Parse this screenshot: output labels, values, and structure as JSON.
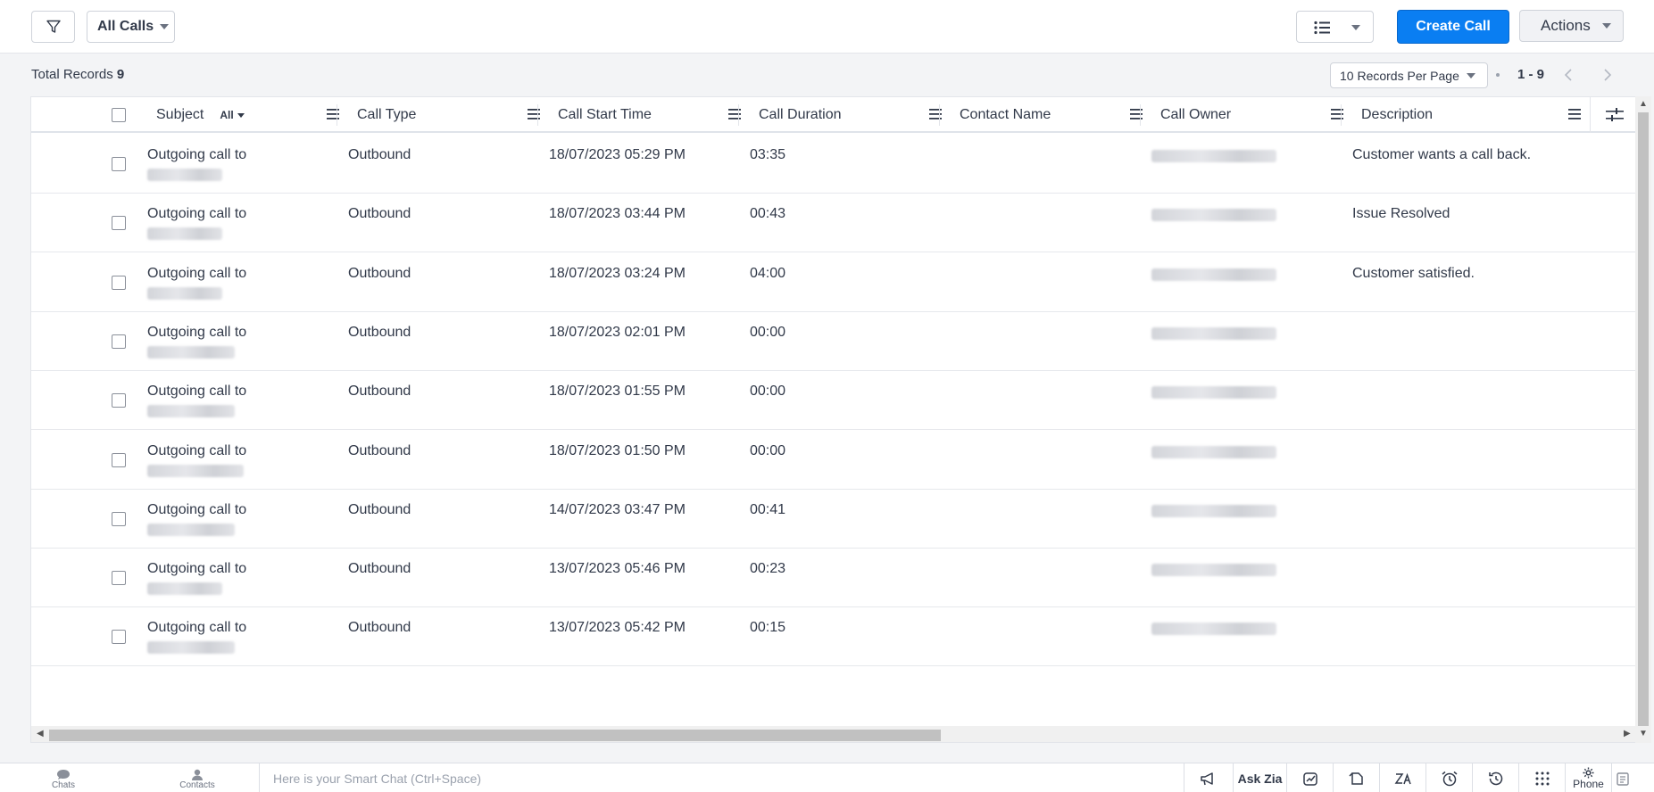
{
  "toolbar": {
    "view_name": "All Calls",
    "create_label": "Create Call",
    "actions_label": "Actions"
  },
  "records": {
    "total_label": "Total Records",
    "total_count": "9",
    "per_page": "10 Records Per Page",
    "range": "1 - 9"
  },
  "table": {
    "columns": [
      {
        "label": "Subject",
        "filter": "All"
      },
      {
        "label": "Call Type"
      },
      {
        "label": "Call Start Time"
      },
      {
        "label": "Call Duration"
      },
      {
        "label": "Contact Name"
      },
      {
        "label": "Call Owner"
      },
      {
        "label": "Description"
      }
    ],
    "rows": [
      {
        "subject": "Outgoing call to",
        "type": "Outbound",
        "start": "18/07/2023 05:29 PM",
        "duration": "03:35",
        "contact": "",
        "description": "Customer wants a call back."
      },
      {
        "subject": "Outgoing call to",
        "type": "Outbound",
        "start": "18/07/2023 03:44 PM",
        "duration": "00:43",
        "contact": "",
        "description": "Issue Resolved"
      },
      {
        "subject": "Outgoing call to",
        "type": "Outbound",
        "start": "18/07/2023 03:24 PM",
        "duration": "04:00",
        "contact": "",
        "description": "Customer satisfied."
      },
      {
        "subject": "Outgoing call to",
        "type": "Outbound",
        "start": "18/07/2023 02:01 PM",
        "duration": "00:00",
        "contact": "",
        "description": ""
      },
      {
        "subject": "Outgoing call to",
        "type": "Outbound",
        "start": "18/07/2023 01:55 PM",
        "duration": "00:00",
        "contact": "",
        "description": ""
      },
      {
        "subject": "Outgoing call to",
        "type": "Outbound",
        "start": "18/07/2023 01:50 PM",
        "duration": "00:00",
        "contact": "",
        "description": ""
      },
      {
        "subject": "Outgoing call to",
        "type": "Outbound",
        "start": "14/07/2023 03:47 PM",
        "duration": "00:41",
        "contact": "",
        "description": ""
      },
      {
        "subject": "Outgoing call to",
        "type": "Outbound",
        "start": "13/07/2023 05:46 PM",
        "duration": "00:23",
        "contact": "",
        "description": ""
      },
      {
        "subject": "Outgoing call to",
        "type": "Outbound",
        "start": "13/07/2023 05:42 PM",
        "duration": "00:15",
        "contact": "",
        "description": ""
      }
    ]
  },
  "bottombar": {
    "chats_label": "Chats",
    "contacts_label": "Contacts",
    "smart_chat_placeholder": "Here is your Smart Chat (Ctrl+Space)",
    "ask_zia_label": "Ask Zia",
    "phone_label": "Phone"
  },
  "colors": {
    "primary": "#0a7ef2",
    "text": "#313949",
    "border": "#cfd3da"
  }
}
